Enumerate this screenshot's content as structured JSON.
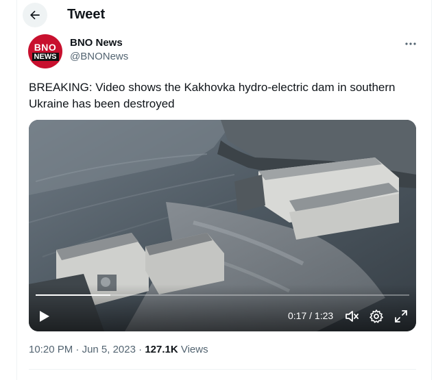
{
  "header": {
    "title": "Tweet"
  },
  "author": {
    "avatar_top": "BNO",
    "avatar_bottom": "NEWS",
    "name": "BNO News",
    "handle": "@BNONews"
  },
  "tweet": {
    "text": "BREAKING: Video shows the Kakhovka hydro-electric dam in southern Ukraine has been destroyed"
  },
  "video": {
    "time": "0:17 / 1:23",
    "progress": 0.2
  },
  "meta": {
    "time": "10:20 PM",
    "sep1": " · ",
    "date": "Jun 5, 2023",
    "sep2": " · ",
    "views_count": "127.1K",
    "views_label": " Views"
  },
  "colors": {
    "text_primary": "#0f1419",
    "text_secondary": "#536471",
    "avatar_red": "#c8102e"
  },
  "icons": {
    "back": "arrow-left-icon",
    "more": "more-horizontal-icon",
    "play": "play-icon",
    "volume": "volume-muted-icon",
    "settings": "gear-icon",
    "fullscreen": "fullscreen-icon"
  }
}
